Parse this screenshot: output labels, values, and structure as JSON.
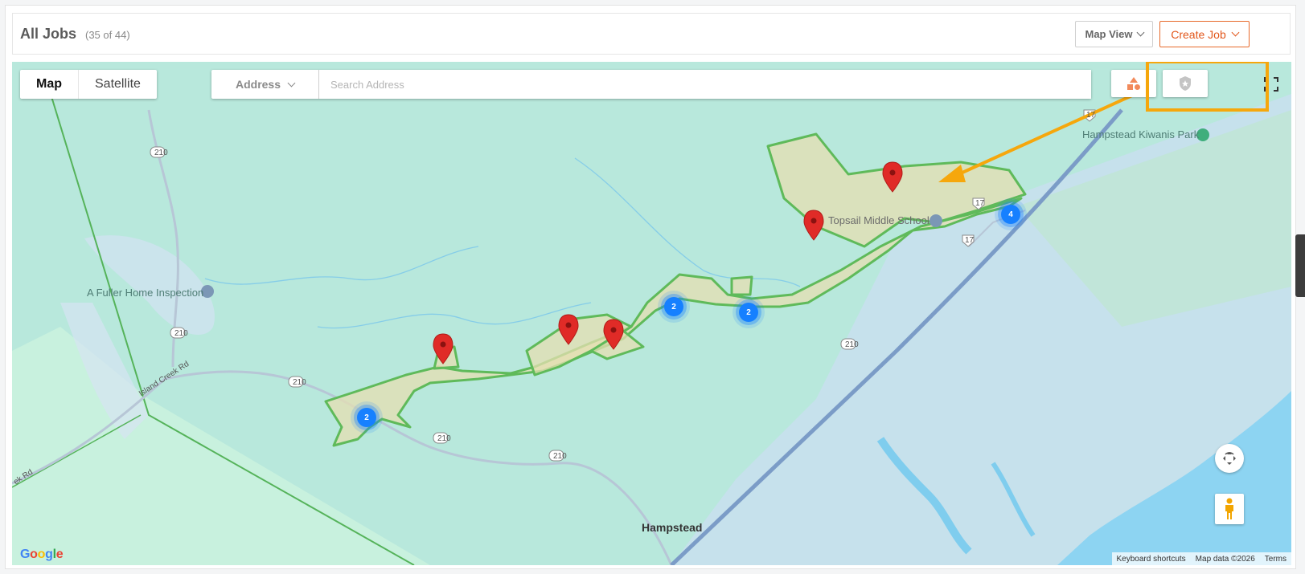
{
  "header": {
    "title": "All Jobs",
    "count": "(35 of 44)",
    "map_view_label": "Map View",
    "create_job_label": "Create Job"
  },
  "map": {
    "type_map_label": "Map",
    "type_satellite_label": "Satellite",
    "search_type_label": "Address",
    "search_placeholder": "Search Address",
    "labels": {
      "park": "Hampstead Kiwanis Park",
      "school": "Topsail Middle School",
      "poi": "A Fuller Home Inspection",
      "town": "Hampstead",
      "road_island_creek": "Island Creek Rd",
      "road_ek": "ek Rd",
      "road_210": "210",
      "road_17": "17"
    },
    "clusters": [
      "2",
      "2",
      "2",
      "4"
    ],
    "footer": {
      "shortcuts": "Keyboard shortcuts",
      "mapdata": "Map data ©2026",
      "terms": "Terms"
    },
    "google_logo": "Google"
  },
  "colors": {
    "accent": "#e2561a",
    "highlight": "#f6a70c",
    "cluster": "#1680ff",
    "marker": "#e02b27",
    "zone_stroke": "#5fba5a",
    "zone_fill": "#e6dfb2"
  },
  "icons": {
    "draw_shape_tool": "shapes-icon",
    "territory_tool": "shield-star-icon",
    "fullscreen": "fullscreen-icon",
    "rotate": "rotate-icon",
    "pegman": "pegman-icon"
  }
}
